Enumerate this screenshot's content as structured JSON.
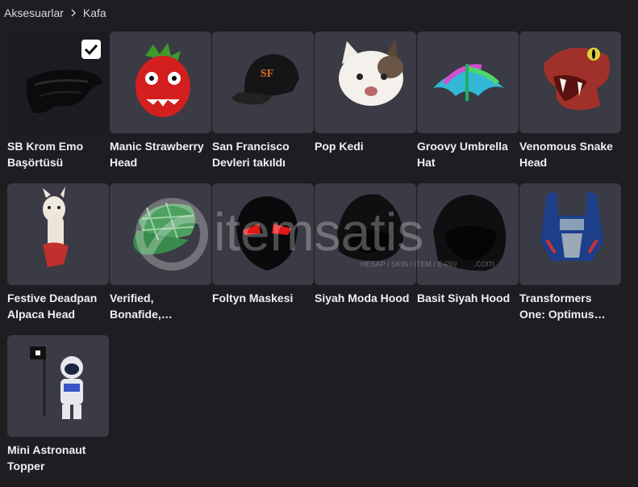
{
  "breadcrumb": {
    "parent": "Aksesuarlar",
    "current": "Kafa"
  },
  "items": [
    {
      "name": "SB Krom Emo Başörtüsü",
      "icon": "black-headscarf-icon",
      "selected": true
    },
    {
      "name": "Manic Strawberry Head",
      "icon": "strawberry-head-icon"
    },
    {
      "name": "San Francisco Devleri takıldı",
      "icon": "baseball-cap-icon"
    },
    {
      "name": "Pop Kedi",
      "icon": "cat-head-icon"
    },
    {
      "name": "Groovy Umbrella Hat",
      "icon": "umbrella-hat-icon"
    },
    {
      "name": "Venomous Snake Head",
      "icon": "snake-head-icon"
    },
    {
      "name": "Festive Deadpan Alpaca Head",
      "icon": "alpaca-head-icon"
    },
    {
      "name": "Verified, Bonafide, Plaidafied",
      "icon": "plaid-cap-icon"
    },
    {
      "name": "Foltyn Maskesi",
      "icon": "red-eye-mask-icon"
    },
    {
      "name": "Siyah Moda Hood",
      "icon": "black-hood-icon"
    },
    {
      "name": "Basit Siyah Hood",
      "icon": "black-hood-icon"
    },
    {
      "name": "Transformers One: Optimus Prime...",
      "icon": "optimus-helmet-icon"
    },
    {
      "name": "Mini Astronaut Topper",
      "icon": "astronaut-topper-icon"
    }
  ],
  "watermark": {
    "brand": "itemsatis",
    "tagline": "HESAP / SKIN / ITEM / E-PIN",
    "suffix": ".com"
  },
  "colors": {
    "background": "#1d1d22",
    "tile": "#3a3b44",
    "tile_selected": "#1b1c21",
    "text": "#f0f0f2"
  }
}
